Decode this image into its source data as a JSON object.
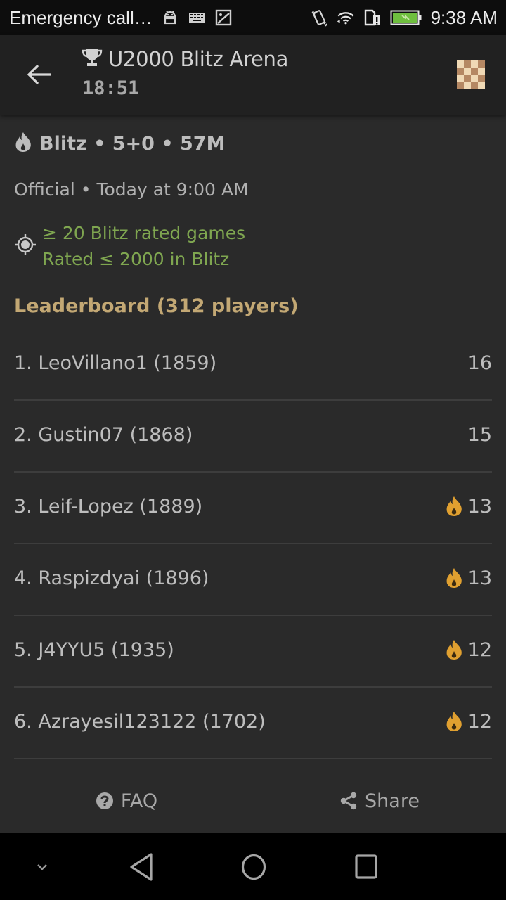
{
  "status_bar": {
    "carrier_text": "Emergency call…",
    "time": "9:38 AM",
    "left_icons": [
      "android-icon",
      "keyboard-icon",
      "image-icon"
    ],
    "right_icons": [
      "vibrate-icon",
      "wifi-icon",
      "sim-alert-icon",
      "battery-charging-icon"
    ],
    "battery_color": "#6fbf3f"
  },
  "app_bar": {
    "back_icon": "arrow-left-icon",
    "title_icon": "trophy-icon",
    "title": "U2000 Blitz Arena",
    "clock": "18:51",
    "board_icon": "chessboard-icon"
  },
  "tournament": {
    "perf_icon": "fire-icon",
    "perf": "Blitz • 5+0 • 57M",
    "official": "Official • Today at 9:00 AM",
    "conditions_icon": "crosshair-icon",
    "conditions": [
      "≥ 20 Blitz rated games",
      "Rated ≤ 2000 in Blitz"
    ],
    "conditions_color": "#7fa650"
  },
  "leaderboard": {
    "title": "Leaderboard (312 players)",
    "title_color": "#c3a874",
    "fire_color": "#e0a030",
    "rows": [
      {
        "label": "1. LeoVillano1 (1859)",
        "score": "16",
        "on_fire": false
      },
      {
        "label": "2. Gustin07 (1868)",
        "score": "15",
        "on_fire": false
      },
      {
        "label": "3. Leif-Lopez (1889)",
        "score": "13",
        "on_fire": true
      },
      {
        "label": "4. Raspizdyai (1896)",
        "score": "13",
        "on_fire": true
      },
      {
        "label": "5. J4YYU5 (1935)",
        "score": "12",
        "on_fire": true
      },
      {
        "label": "6. Azrayesil123122 (1702)",
        "score": "12",
        "on_fire": true
      }
    ]
  },
  "footer": {
    "faq_label": "FAQ",
    "faq_icon": "question-circle-icon",
    "share_label": "Share",
    "share_icon": "share-icon"
  },
  "nav_bar": {
    "items": [
      "chevron-down-icon",
      "back-triangle-icon",
      "home-circle-icon",
      "recents-square-icon"
    ]
  }
}
